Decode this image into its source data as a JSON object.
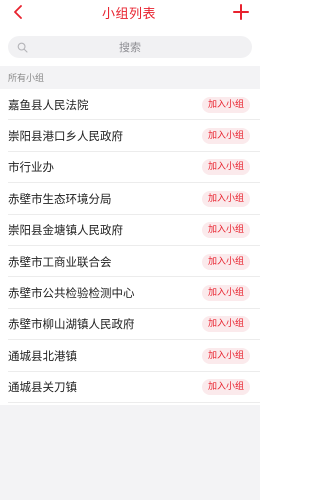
{
  "header": {
    "title": "小组列表",
    "accent_color": "#e8222e",
    "back_icon": "chevron-left-icon",
    "add_icon": "plus-icon"
  },
  "search": {
    "placeholder": "搜索",
    "icon": "search-icon"
  },
  "section": {
    "title": "所有小组"
  },
  "groups": [
    {
      "name": "嘉鱼县人民法院",
      "action": "加入小组"
    },
    {
      "name": "崇阳县港口乡人民政府",
      "action": "加入小组"
    },
    {
      "name": "市行业办",
      "action": "加入小组"
    },
    {
      "name": "赤壁市生态环境分局",
      "action": "加入小组"
    },
    {
      "name": "崇阳县金塘镇人民政府",
      "action": "加入小组"
    },
    {
      "name": "赤壁市工商业联合会",
      "action": "加入小组"
    },
    {
      "name": "赤壁市公共检验检测中心",
      "action": "加入小组"
    },
    {
      "name": "赤壁市柳山湖镇人民政府",
      "action": "加入小组"
    },
    {
      "name": "通城县北港镇",
      "action": "加入小组"
    },
    {
      "name": "通城县关刀镇",
      "action": "加入小组"
    }
  ]
}
